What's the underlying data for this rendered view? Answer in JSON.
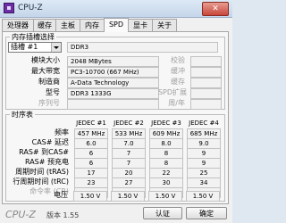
{
  "window": {
    "title": "CPU-Z",
    "close_glyph": "✕"
  },
  "tabs": [
    "处理器",
    "缓存",
    "主板",
    "内存",
    "SPD",
    "显卡",
    "关于"
  ],
  "slot_group": {
    "title": "内存插槽选择",
    "slot_value": "插槽 #1",
    "memory_type": "DDR3",
    "rows": [
      {
        "label": "模块大小",
        "value": "2048 MBytes",
        "right_label": "校验"
      },
      {
        "label": "最大带宽",
        "value": "PC3-10700 (667 MHz)",
        "right_label": "缓冲"
      },
      {
        "label": "制造商",
        "value": "A-Data Technology",
        "right_label": "缓存"
      },
      {
        "label": "型号",
        "value": "DDR3 1333G",
        "right_label": "SPD扩展"
      },
      {
        "label": "序列号",
        "value": "",
        "right_label": "周/年"
      }
    ]
  },
  "timing_group": {
    "title": "时序表",
    "headers": [
      "JEDEC #1",
      "JEDEC #2",
      "JEDEC #3",
      "JEDEC #4"
    ],
    "rows": [
      {
        "label": "频率",
        "values": [
          "457 MHz",
          "533 MHz",
          "609 MHz",
          "685 MHz"
        ]
      },
      {
        "label": "CAS# 延迟",
        "values": [
          "6.0",
          "7.0",
          "8.0",
          "9.0"
        ]
      },
      {
        "label": "RAS# 到CAS#",
        "values": [
          "6",
          "7",
          "8",
          "9"
        ]
      },
      {
        "label": "RAS# 预充电",
        "values": [
          "6",
          "7",
          "8",
          "9"
        ]
      },
      {
        "label": "周期时间 (tRAS)",
        "values": [
          "17",
          "20",
          "22",
          "25"
        ]
      },
      {
        "label": "行周期时间 (tRC)",
        "values": [
          "23",
          "27",
          "30",
          "34"
        ]
      },
      {
        "label": "命令率 (CR)",
        "values": [
          "",
          "",
          "",
          ""
        ]
      },
      {
        "label": "电压",
        "values": [
          "1.50 V",
          "1.50 V",
          "1.50 V",
          "1.50 V"
        ]
      }
    ]
  },
  "footer": {
    "brand": "CPU-Z",
    "version": "版本 1.55",
    "ok_button": "认证",
    "confirm_button": "确定"
  }
}
